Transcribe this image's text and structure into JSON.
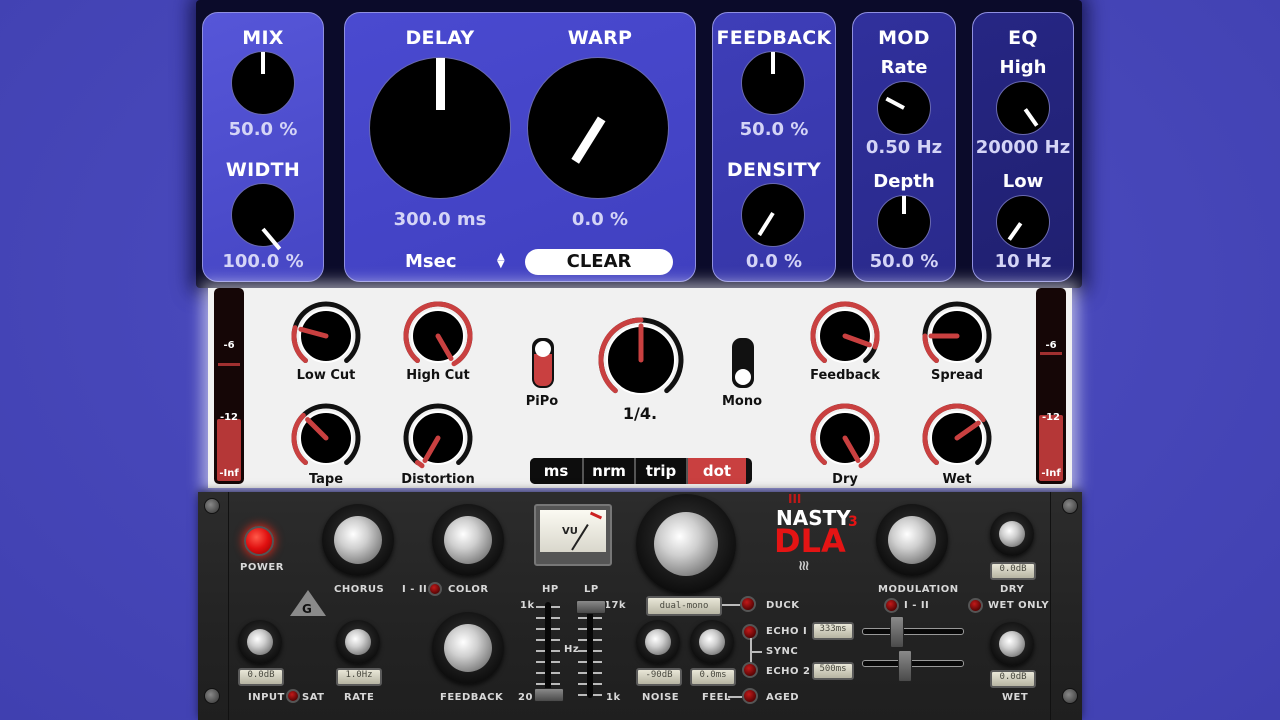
{
  "top_plugin": {
    "mix": {
      "title": "MIX",
      "value": "50.0 %"
    },
    "width": {
      "title": "WIDTH",
      "value": "100.0 %"
    },
    "delay": {
      "title": "DELAY",
      "value": "300.0 ms"
    },
    "warp": {
      "title": "WARP",
      "value": "0.0 %"
    },
    "time_mode": {
      "selected": "Msec"
    },
    "clear_label": "CLEAR",
    "feedback": {
      "title": "FEEDBACK",
      "value": "50.0 %"
    },
    "density": {
      "title": "DENSITY",
      "value": "0.0 %"
    },
    "mod": {
      "title": "MOD",
      "rate_label": "Rate",
      "rate_value": "0.50 Hz",
      "depth_label": "Depth",
      "depth_value": "50.0 %"
    },
    "eq": {
      "title": "EQ",
      "high_label": "High",
      "high_value": "20000 Hz",
      "low_label": "Low",
      "low_value": "10 Hz"
    }
  },
  "mid_plugin": {
    "meter_left": {
      "mark_top": "-6",
      "mark_mid": "-12",
      "mark_bottom": "-Inf"
    },
    "meter_right": {
      "mark_top": "-6",
      "mark_mid": "-12",
      "mark_bottom": "-Inf"
    },
    "knobs": {
      "low_cut": "Low Cut",
      "high_cut": "High Cut",
      "tape": "Tape",
      "distortion": "Distortion",
      "feedback": "Feedback",
      "spread": "Spread",
      "dry": "Dry",
      "wet": "Wet"
    },
    "pipo_label": "PiPo",
    "mono_label": "Mono",
    "time_value": "1/4.",
    "modes": [
      "ms",
      "nrm",
      "trip",
      "dot"
    ],
    "active_mode": "dot"
  },
  "hardware": {
    "power_label": "POWER",
    "chorus_label": "CHORUS",
    "color_label": "COLOR",
    "i_ii_label": "I - II",
    "input_label": "INPUT",
    "input_value": "0.0dB",
    "sat_label": "SAT",
    "rate_label": "RATE",
    "rate_value": "1.0Hz",
    "feedback_label": "FEEDBACK",
    "vu_label": "VU",
    "hp_label": "HP",
    "lp_label": "LP",
    "hz_label": "Hz",
    "hp_top": "1k",
    "hp_bottom": "20",
    "lp_top": "17k",
    "lp_bottom": "1k",
    "mode_display": "dual-mono",
    "duck_label": "DUCK",
    "noise_label": "NOISE",
    "noise_value": "-90dB",
    "feel_label": "FEEL",
    "feel_value": "0.0ms",
    "echo1_label": "ECHO I",
    "echo2_label": "ECHO 2",
    "sync_label": "SYNC",
    "aged_label": "AGED",
    "echo1_time": "333ms",
    "echo2_time": "500ms",
    "brand_top": "NASTY",
    "brand_main": "DLA",
    "brand_sup": "3",
    "modulation_label": "MODULATION",
    "mod_i_ii_label": "I - II",
    "dry_label": "DRY",
    "dry_value": "0.0dB",
    "wet_only_label": "WET ONLY",
    "wet_label": "WET",
    "wet_value": "0.0dB",
    "logo_letter": "G"
  },
  "colors": {
    "background": "#4848bc",
    "accent_red": "#c94040",
    "panel_blue": "#4a4ad0"
  }
}
